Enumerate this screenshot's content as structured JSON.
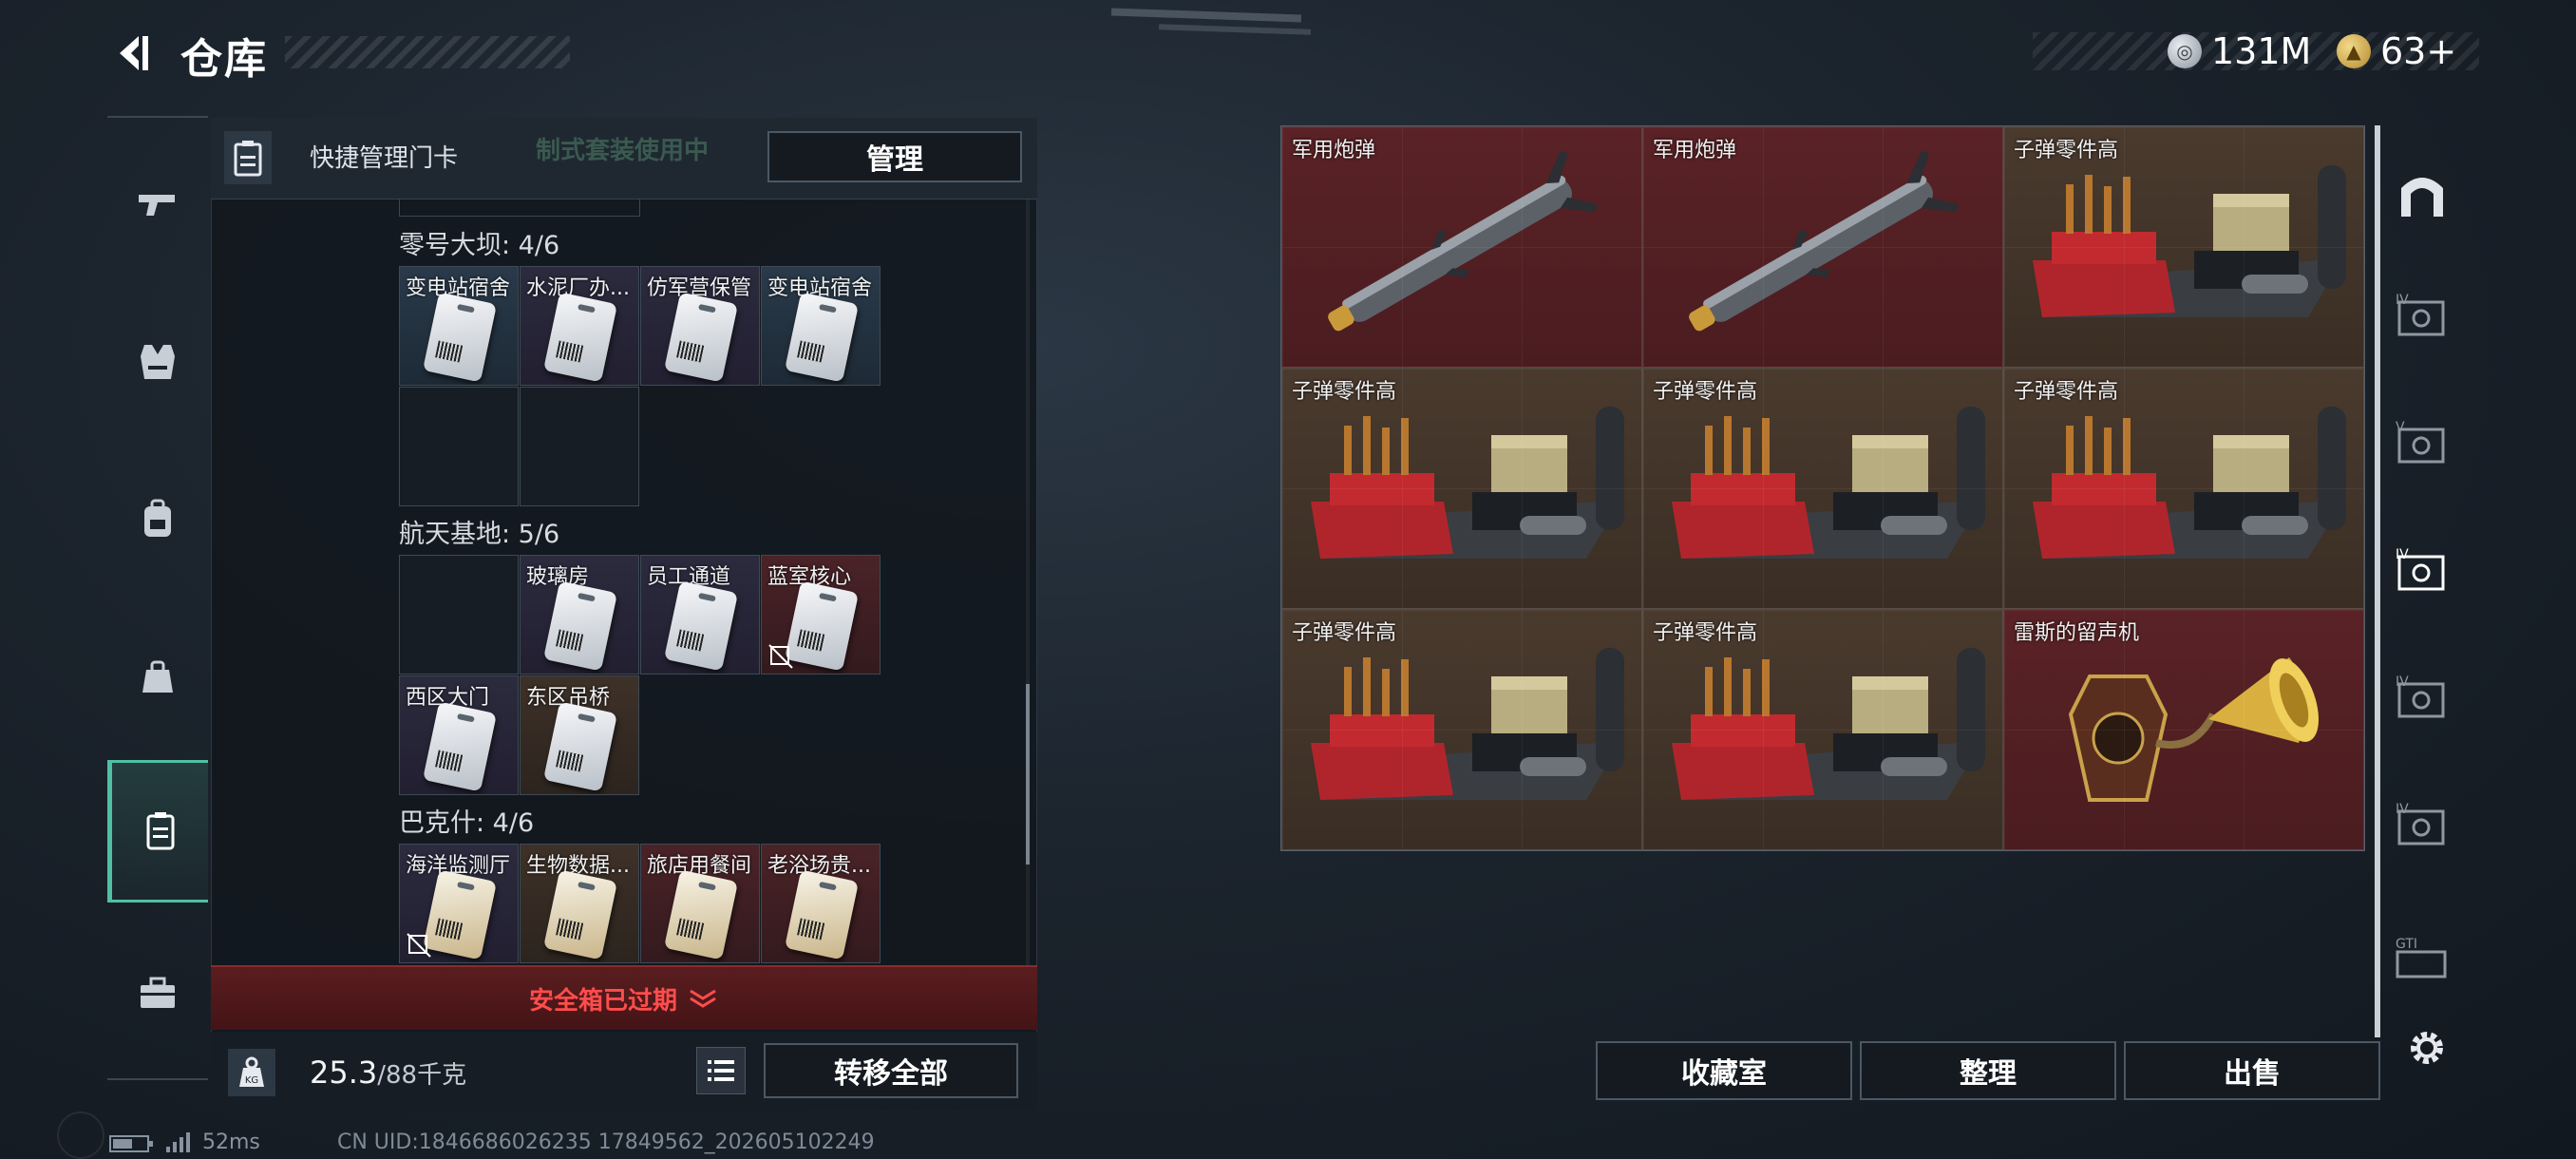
{
  "header": {
    "title": "仓库"
  },
  "currency": [
    {
      "icon": "silver-coin-icon",
      "value": "131M"
    },
    {
      "icon": "gold-coin-icon",
      "value": "63+"
    }
  ],
  "left_nav": [
    {
      "name": "weapons",
      "icon": "gun-icon",
      "active": false
    },
    {
      "name": "armor",
      "icon": "vest-icon",
      "active": false
    },
    {
      "name": "backpack",
      "icon": "backpack-icon",
      "active": false
    },
    {
      "name": "pouch",
      "icon": "pouch-icon",
      "active": false
    },
    {
      "name": "keycards",
      "icon": "keycard-icon",
      "active": true
    },
    {
      "name": "toolbox",
      "icon": "toolbox-icon",
      "active": false
    }
  ],
  "panel": {
    "header_label": "快捷管理门卡",
    "header_ghost": "制式套装使用中",
    "manage_button": "管理",
    "regions": [
      {
        "title": "零号大坝: 4/6",
        "slots": [
          {
            "label": "变电站宿舍",
            "rarity": "blue"
          },
          {
            "label": "水泥厂办...",
            "rarity": "purple"
          },
          {
            "label": "仿军营保管",
            "rarity": "purple"
          },
          {
            "label": "变电站宿舍",
            "rarity": "blue"
          }
        ]
      },
      {
        "title": "航天基地: 5/6",
        "slots": [
          {
            "label": "玻璃房",
            "rarity": "purple"
          },
          {
            "label": "员工通道",
            "rarity": "purple"
          },
          {
            "label": "蓝室核心",
            "rarity": "red"
          },
          {
            "label": "西区大门",
            "rarity": "purple"
          },
          {
            "label": "东区吊桥",
            "rarity": "brown"
          }
        ]
      },
      {
        "title": "巴克什: 4/6",
        "slots": [
          {
            "label": "海洋监测厅",
            "rarity": "purple"
          },
          {
            "label": "生物数据...",
            "rarity": "brown"
          },
          {
            "label": "旅店用餐间",
            "rarity": "red"
          },
          {
            "label": "老浴场贵...",
            "rarity": "red"
          }
        ]
      }
    ],
    "expired_text": "安全箱已过期",
    "weight_value": "25.3",
    "weight_max": "/88千克",
    "transfer_button": "转移全部"
  },
  "grid_items": [
    {
      "label": "军用炮弹",
      "kind": "missile",
      "rarity": "red"
    },
    {
      "label": "军用炮弹",
      "kind": "missile",
      "rarity": "red"
    },
    {
      "label": "子弹零件高",
      "kind": "ammo",
      "rarity": "gold"
    },
    {
      "label": "子弹零件高",
      "kind": "ammo",
      "rarity": "gold"
    },
    {
      "label": "子弹零件高",
      "kind": "ammo",
      "rarity": "gold"
    },
    {
      "label": "子弹零件高",
      "kind": "ammo",
      "rarity": "gold"
    },
    {
      "label": "子弹零件高",
      "kind": "ammo",
      "rarity": "gold"
    },
    {
      "label": "子弹零件高",
      "kind": "ammo",
      "rarity": "gold"
    },
    {
      "label": "雷斯的留声机",
      "kind": "gramophone",
      "rarity": "red"
    }
  ],
  "right_nav": [
    {
      "icon": "arch-icon",
      "label": ""
    },
    {
      "icon": "safe-iv-icon",
      "label": "IV"
    },
    {
      "icon": "safe-v-icon",
      "label": "V"
    },
    {
      "icon": "safe-iv-active-icon",
      "label": "IV"
    },
    {
      "icon": "safe-iv-icon",
      "label": "IV"
    },
    {
      "icon": "safe-iv-icon",
      "label": "IV"
    },
    {
      "icon": "gti-icon",
      "label": "GTI"
    }
  ],
  "bottom_buttons": {
    "collection": "收藏室",
    "sort": "整理",
    "sell": "出售"
  },
  "status_bar": {
    "ping": "52ms",
    "uid": "CN UID:1846686026235 17849562_202605102249"
  },
  "colors": {
    "accent": "#4fc0a4",
    "expired": "#ff4d4d",
    "rarity_red": "#4a1c20",
    "rarity_gold": "#3a2e24"
  }
}
